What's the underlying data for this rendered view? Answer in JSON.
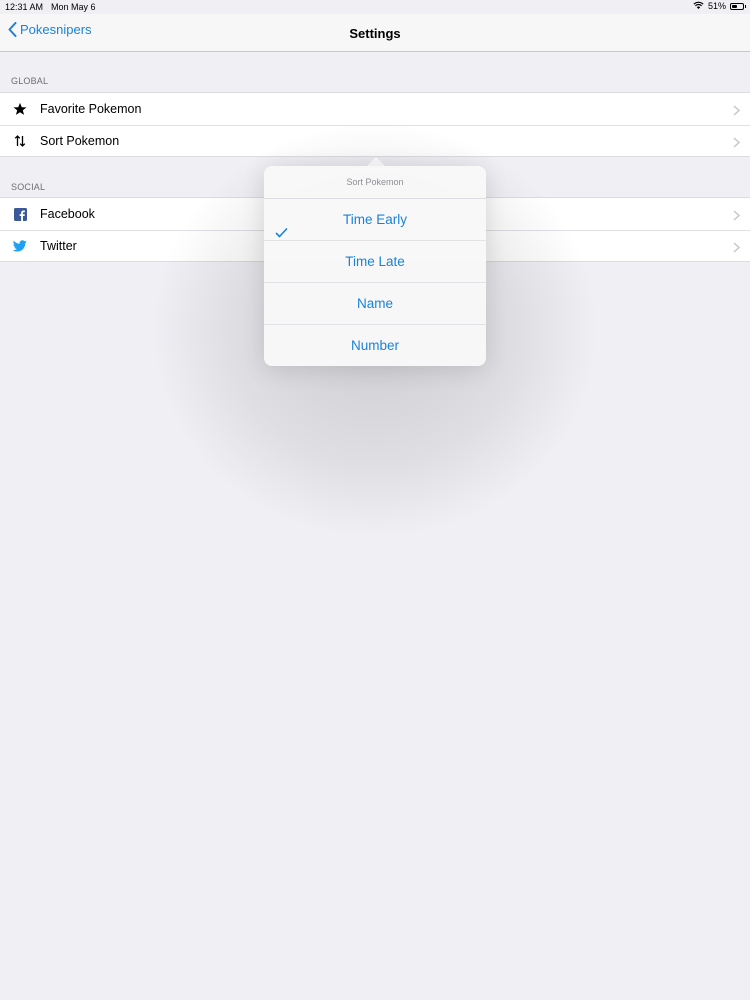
{
  "status": {
    "time": "12:31 AM",
    "date": "Mon May 6",
    "battery": "51%",
    "battery_fill": 0.51
  },
  "nav": {
    "back_label": "Pokesnipers",
    "title": "Settings"
  },
  "sections": [
    {
      "header": "GLOBAL",
      "items": [
        {
          "label": "Favorite Pokemon",
          "icon": "star-icon"
        },
        {
          "label": "Sort Pokemon",
          "icon": "sort-arrows-icon"
        }
      ]
    },
    {
      "header": "SOCIAL",
      "items": [
        {
          "label": "Facebook",
          "icon": "facebook-icon"
        },
        {
          "label": "Twitter",
          "icon": "twitter-icon"
        }
      ]
    }
  ],
  "popover": {
    "title": "Sort Pokemon",
    "options": [
      "Time Early",
      "Time Late",
      "Name",
      "Number"
    ],
    "selected": "Time Early"
  },
  "colors": {
    "accent": "#1a82d8",
    "background": "#efeff4",
    "facebook": "#3b5998",
    "twitter": "#1da1f2"
  }
}
